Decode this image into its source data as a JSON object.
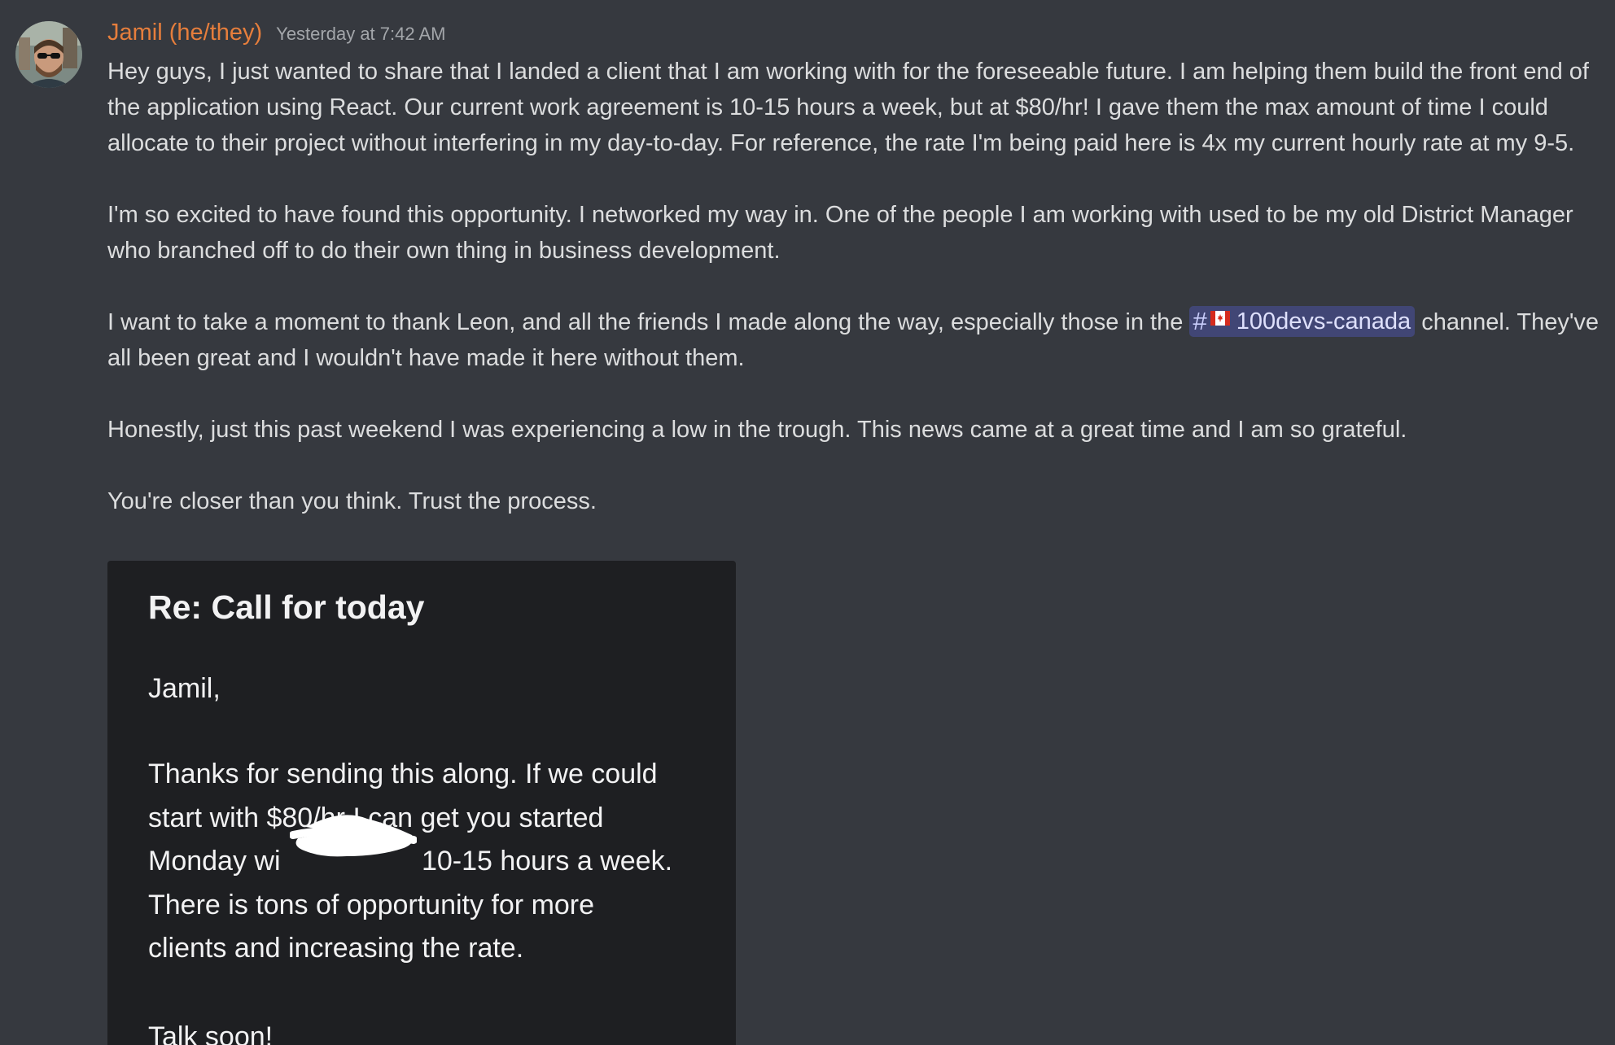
{
  "message": {
    "author": "Jamil (he/they)",
    "timestamp": "Yesterday at 7:42 AM",
    "paragraphs": {
      "p1": "Hey guys, I just wanted to share that I landed a client that I am working with for the foreseeable future. I am helping them build the front end of the application using React. Our current work agreement is 10-15 hours a week, but at $80/hr! I gave them the max amount of time I could allocate to their project without interfering in my day-to-day. For reference, the rate I'm being paid here is 4x my current hourly rate at my 9-5.",
      "p2": "I'm so excited to have found this opportunity. I networked my way in. One of the people I am working with used to be my old District Manager who branched off to do their own thing in business development.",
      "p3_before": "I want to take a moment to thank Leon, and all the friends I made along the way, especially those in the ",
      "p3_after": " channel. They've all been great and I wouldn't have made it here without them.",
      "p4": "Honestly, just this past weekend I was experiencing a low in the trough. This news came at a great time and I am so grateful.",
      "p5": "You're closer than you think. Trust the process."
    },
    "channel_mention": {
      "hash": "#",
      "name": "100devs-canada",
      "icon": "canada-flag-icon"
    }
  },
  "email": {
    "subject": "Re: Call for today",
    "greeting": "Jamil,",
    "body_lines": {
      "l1": "Thanks for sending this along. If we could",
      "l2": "start with $80/hr I can get you started",
      "l3a": "Monday wi",
      "l3b": " 10-15 hours a week.",
      "l4": "There is tons of opportunity for more",
      "l5": "clients and increasing the rate."
    },
    "signoff": "Talk soon!"
  },
  "colors": {
    "background": "#36393f",
    "username": "#e67e3c",
    "timestamp": "#a3a6aa",
    "text": "#dcddde",
    "mention_bg": "#414675",
    "mention_text": "#dee0fc",
    "email_bg": "#1e1f22"
  }
}
